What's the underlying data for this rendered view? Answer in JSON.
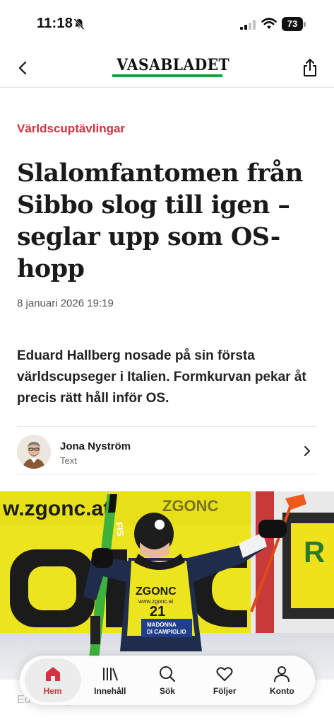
{
  "status_bar": {
    "time": "11:18",
    "battery": "73"
  },
  "header": {
    "logo_text": "VASABLADET",
    "brand_color": "#1f9a3f"
  },
  "article": {
    "category": "Världscuptävlingar",
    "category_color": "#d4333f",
    "headline": "Slalomfantomen från Sibbo slog till igen – seglar upp som OS-hopp",
    "date": "8 januari 2026 19:19",
    "lead": "Eduard Hallberg nosade på sin första världscupseger i Italien. Formkurvan pekar åt precis rätt håll inför OS.",
    "author": {
      "name": "Jona Nyström",
      "role": "Text"
    },
    "image": {
      "banner_text": "w.zgonc.at",
      "banner_brand": "ZGONC",
      "ski_text": "FIS",
      "bib_brand": "ZGONC",
      "bib_url": "www.zgonc.at",
      "bib_number": "21",
      "bib_event_1": "MADONNA",
      "bib_event_2": "DI CAMPIGLIO"
    },
    "body_fade": "Ed säsongen."
  },
  "tab_bar": {
    "tabs": [
      {
        "label": "Hem",
        "icon": "home-icon",
        "active": true
      },
      {
        "label": "Innehåll",
        "icon": "library-icon",
        "active": false
      },
      {
        "label": "Sök",
        "icon": "search-icon",
        "active": false
      },
      {
        "label": "Följer",
        "icon": "heart-icon",
        "active": false
      },
      {
        "label": "Konto",
        "icon": "person-icon",
        "active": false
      }
    ]
  }
}
